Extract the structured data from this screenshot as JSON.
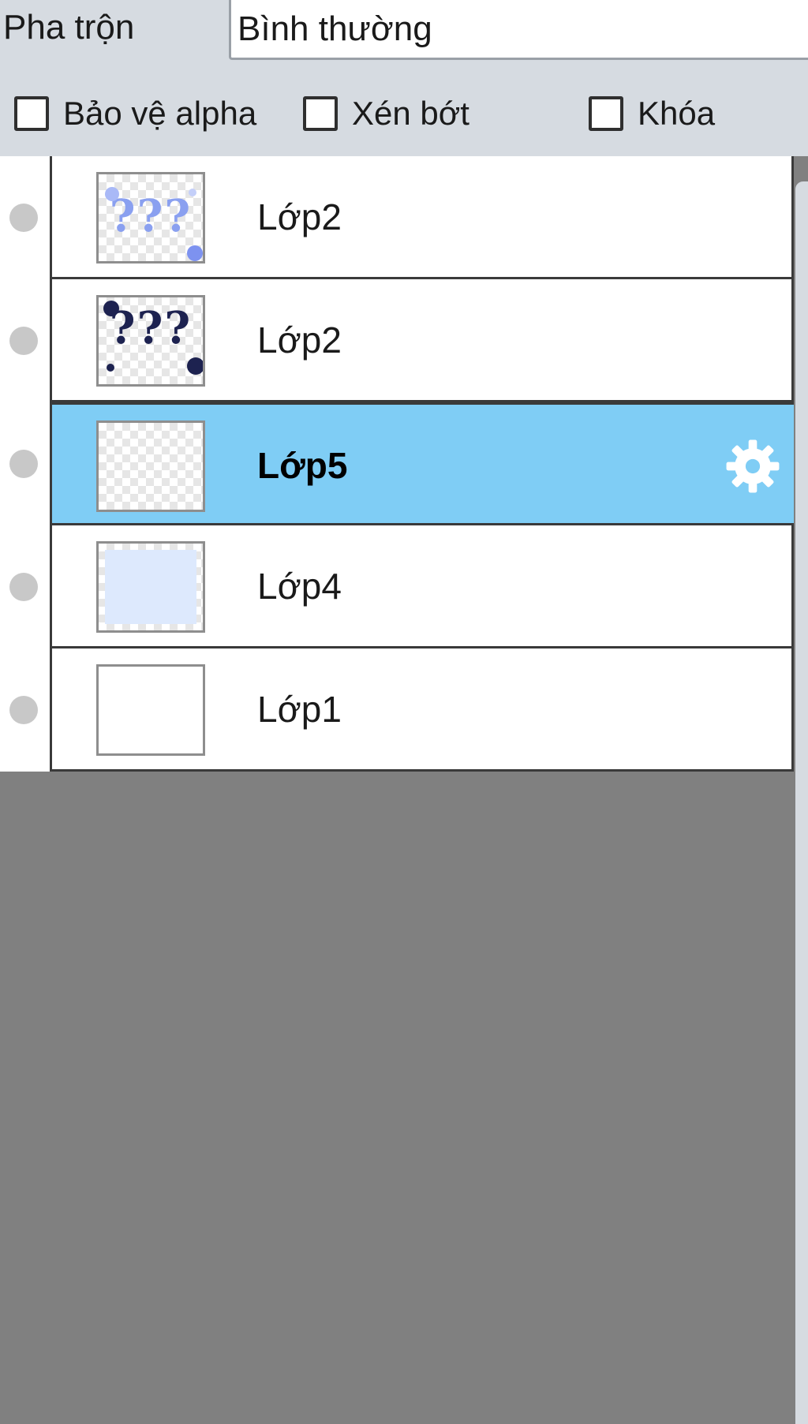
{
  "blend": {
    "label": "Pha trộn",
    "value": "Bình thường"
  },
  "options": {
    "protect_alpha": "Bảo vệ alpha",
    "clip": "Xén bớt",
    "lock": "Khóa"
  },
  "layers": [
    {
      "name": "Lớp2",
      "selected": false,
      "thumbnail": "light-question-marks"
    },
    {
      "name": "Lớp2",
      "selected": false,
      "thumbnail": "dark-question-marks"
    },
    {
      "name": "Lớp5",
      "selected": true,
      "thumbnail": "transparent"
    },
    {
      "name": "Lớp4",
      "selected": false,
      "thumbnail": "light-blue-fill"
    },
    {
      "name": "Lớp1",
      "selected": false,
      "thumbnail": "white"
    }
  ],
  "thumb_text": {
    "light": "???",
    "dark": "???"
  },
  "colors": {
    "selected_row": "#7fcdf5",
    "panel_bg": "#808080",
    "toolbar_bg": "#d6dbe1"
  },
  "icons": {
    "selected_row_icon": "gear-icon",
    "visibility": "visibility-dot"
  }
}
